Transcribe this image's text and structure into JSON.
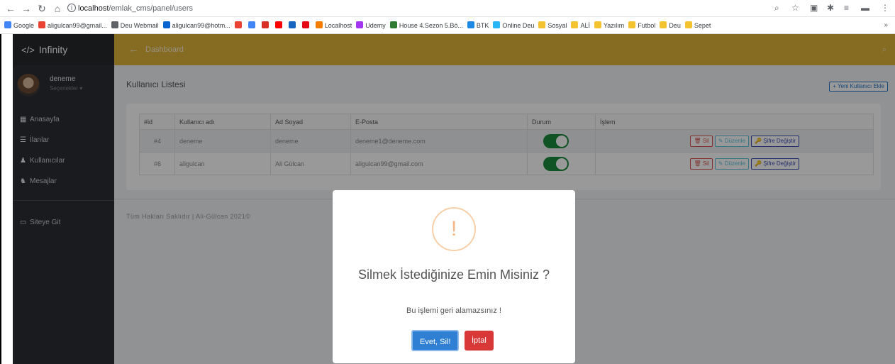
{
  "browser": {
    "url_host": "localhost",
    "url_path": "/emlak_cms/panel/users",
    "bookmarks": [
      {
        "label": "Google",
        "color": "#4285f4"
      },
      {
        "label": "aligulcan99@gmail...",
        "color": "#ea4335"
      },
      {
        "label": "Deu Webmail",
        "color": "#5f6368"
      },
      {
        "label": "aligulcan99@hotm...",
        "color": "#0a64d1"
      },
      {
        "label": "",
        "color": "#ea4335"
      },
      {
        "label": "",
        "color": "#4285f4"
      },
      {
        "label": "",
        "color": "#d93025"
      },
      {
        "label": "",
        "color": "#ff0000"
      },
      {
        "label": "",
        "color": "#1565c0"
      },
      {
        "label": "",
        "color": "#e50914"
      },
      {
        "label": "Localhost",
        "color": "#f57c00"
      },
      {
        "label": "Udemy",
        "color": "#a435f0"
      },
      {
        "label": "House 4.Sezon 5.Bö...",
        "color": "#2e7d32"
      },
      {
        "label": "BTK",
        "color": "#1e88e5"
      },
      {
        "label": "Online Deu",
        "color": "#29b6f6"
      },
      {
        "label": "Sosyal",
        "color": "#f4c430"
      },
      {
        "label": "ALİ",
        "color": "#f4c430"
      },
      {
        "label": "Yazılım",
        "color": "#f4c430"
      },
      {
        "label": "Futbol",
        "color": "#f4c430"
      },
      {
        "label": "Deu",
        "color": "#f4c430"
      },
      {
        "label": "Sepet",
        "color": "#f4c430"
      }
    ],
    "more": "»"
  },
  "sidebar": {
    "brand": "Infinity",
    "user_name": "deneme",
    "user_sub": "Seçenekler ▾",
    "items": [
      {
        "label": "Anasayfa",
        "icon": "dashboard-icon"
      },
      {
        "label": "İlanlar",
        "icon": "list-icon"
      },
      {
        "label": "Kullanıcılar",
        "icon": "user-icon"
      },
      {
        "label": "Mesajlar",
        "icon": "users-icon"
      }
    ],
    "bottom_item": "Siteye Git"
  },
  "topbar": {
    "title": "Dashboard"
  },
  "main": {
    "page_title": "Kullanıcı Listesi",
    "new_user_button": "+ Yeni Kullanıcı Ekle",
    "columns": [
      "#id",
      "Kullanıcı adı",
      "Ad Soyad",
      "E-Posta",
      "Durum",
      "İşlem"
    ],
    "rows": [
      {
        "id": "#4",
        "username": "deneme",
        "fullname": "deneme",
        "email": "deneme1@deneme.com",
        "active": true
      },
      {
        "id": "#6",
        "username": "aligulcan",
        "fullname": "Ali Gülcan",
        "email": "aligulcan99@gmail.com",
        "active": true
      }
    ],
    "actions": {
      "delete": "🗑 Sil",
      "edit": "✎ Düzenle",
      "password": "🔑 Şifre Değiştir"
    },
    "footer": "Tüm Hakları Saklıdır | Ali-Gülcan 2021©"
  },
  "modal": {
    "icon_text": "!",
    "title": "Silmek İstediğinize Emin Misiniz ?",
    "text": "Bu işlemi geri alamazsınız !",
    "confirm": "Evet, Sil!",
    "cancel": "İptal"
  }
}
